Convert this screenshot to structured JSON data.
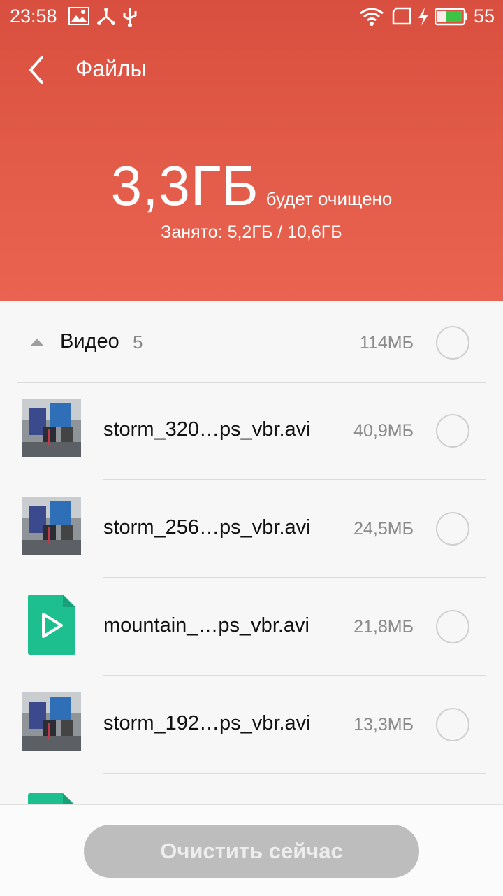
{
  "status_bar": {
    "time": "23:58",
    "battery_level": "55",
    "icons": [
      "image-icon",
      "share-network-icon",
      "usb-icon",
      "wifi-icon",
      "sim-icon",
      "charging-icon",
      "battery-icon"
    ]
  },
  "header": {
    "title": "Файлы",
    "amount": "3,3ГБ",
    "amount_label": "будет очищено",
    "used": "Занято: 5,2ГБ / 10,6ГБ"
  },
  "category": {
    "name": "Видео",
    "count": "5",
    "size": "114МБ"
  },
  "items": [
    {
      "name": "storm_320…ps_vbr.avi",
      "size": "40,9МБ",
      "thumb": "photo"
    },
    {
      "name": "storm_256…ps_vbr.avi",
      "size": "24,5МБ",
      "thumb": "photo"
    },
    {
      "name": "mountain_…ps_vbr.avi",
      "size": "21,8МБ",
      "thumb": "video-file-icon"
    },
    {
      "name": "storm_192…ps_vbr.avi",
      "size": "13,3МБ",
      "thumb": "photo"
    }
  ],
  "action_button": "Очистить сейчас",
  "colors": {
    "header": "#e25a48",
    "video_file": "#1dbf8e",
    "button_disabled": "#bdbdbd"
  }
}
